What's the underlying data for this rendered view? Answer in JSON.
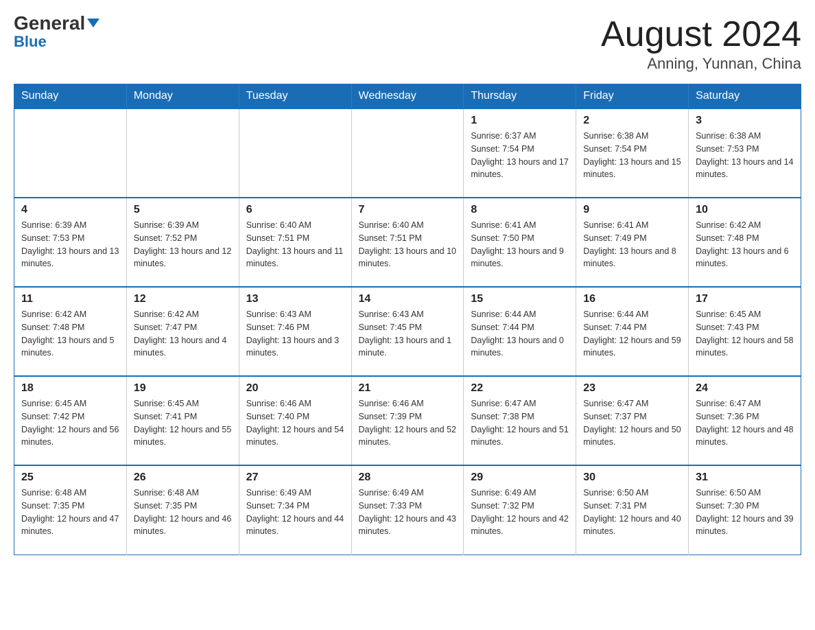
{
  "header": {
    "logo_general": "General",
    "logo_blue": "Blue",
    "title": "August 2024",
    "location": "Anning, Yunnan, China"
  },
  "days_of_week": [
    "Sunday",
    "Monday",
    "Tuesday",
    "Wednesday",
    "Thursday",
    "Friday",
    "Saturday"
  ],
  "weeks": [
    [
      {
        "day": "",
        "info": ""
      },
      {
        "day": "",
        "info": ""
      },
      {
        "day": "",
        "info": ""
      },
      {
        "day": "",
        "info": ""
      },
      {
        "day": "1",
        "info": "Sunrise: 6:37 AM\nSunset: 7:54 PM\nDaylight: 13 hours and 17 minutes."
      },
      {
        "day": "2",
        "info": "Sunrise: 6:38 AM\nSunset: 7:54 PM\nDaylight: 13 hours and 15 minutes."
      },
      {
        "day": "3",
        "info": "Sunrise: 6:38 AM\nSunset: 7:53 PM\nDaylight: 13 hours and 14 minutes."
      }
    ],
    [
      {
        "day": "4",
        "info": "Sunrise: 6:39 AM\nSunset: 7:53 PM\nDaylight: 13 hours and 13 minutes."
      },
      {
        "day": "5",
        "info": "Sunrise: 6:39 AM\nSunset: 7:52 PM\nDaylight: 13 hours and 12 minutes."
      },
      {
        "day": "6",
        "info": "Sunrise: 6:40 AM\nSunset: 7:51 PM\nDaylight: 13 hours and 11 minutes."
      },
      {
        "day": "7",
        "info": "Sunrise: 6:40 AM\nSunset: 7:51 PM\nDaylight: 13 hours and 10 minutes."
      },
      {
        "day": "8",
        "info": "Sunrise: 6:41 AM\nSunset: 7:50 PM\nDaylight: 13 hours and 9 minutes."
      },
      {
        "day": "9",
        "info": "Sunrise: 6:41 AM\nSunset: 7:49 PM\nDaylight: 13 hours and 8 minutes."
      },
      {
        "day": "10",
        "info": "Sunrise: 6:42 AM\nSunset: 7:48 PM\nDaylight: 13 hours and 6 minutes."
      }
    ],
    [
      {
        "day": "11",
        "info": "Sunrise: 6:42 AM\nSunset: 7:48 PM\nDaylight: 13 hours and 5 minutes."
      },
      {
        "day": "12",
        "info": "Sunrise: 6:42 AM\nSunset: 7:47 PM\nDaylight: 13 hours and 4 minutes."
      },
      {
        "day": "13",
        "info": "Sunrise: 6:43 AM\nSunset: 7:46 PM\nDaylight: 13 hours and 3 minutes."
      },
      {
        "day": "14",
        "info": "Sunrise: 6:43 AM\nSunset: 7:45 PM\nDaylight: 13 hours and 1 minute."
      },
      {
        "day": "15",
        "info": "Sunrise: 6:44 AM\nSunset: 7:44 PM\nDaylight: 13 hours and 0 minutes."
      },
      {
        "day": "16",
        "info": "Sunrise: 6:44 AM\nSunset: 7:44 PM\nDaylight: 12 hours and 59 minutes."
      },
      {
        "day": "17",
        "info": "Sunrise: 6:45 AM\nSunset: 7:43 PM\nDaylight: 12 hours and 58 minutes."
      }
    ],
    [
      {
        "day": "18",
        "info": "Sunrise: 6:45 AM\nSunset: 7:42 PM\nDaylight: 12 hours and 56 minutes."
      },
      {
        "day": "19",
        "info": "Sunrise: 6:45 AM\nSunset: 7:41 PM\nDaylight: 12 hours and 55 minutes."
      },
      {
        "day": "20",
        "info": "Sunrise: 6:46 AM\nSunset: 7:40 PM\nDaylight: 12 hours and 54 minutes."
      },
      {
        "day": "21",
        "info": "Sunrise: 6:46 AM\nSunset: 7:39 PM\nDaylight: 12 hours and 52 minutes."
      },
      {
        "day": "22",
        "info": "Sunrise: 6:47 AM\nSunset: 7:38 PM\nDaylight: 12 hours and 51 minutes."
      },
      {
        "day": "23",
        "info": "Sunrise: 6:47 AM\nSunset: 7:37 PM\nDaylight: 12 hours and 50 minutes."
      },
      {
        "day": "24",
        "info": "Sunrise: 6:47 AM\nSunset: 7:36 PM\nDaylight: 12 hours and 48 minutes."
      }
    ],
    [
      {
        "day": "25",
        "info": "Sunrise: 6:48 AM\nSunset: 7:35 PM\nDaylight: 12 hours and 47 minutes."
      },
      {
        "day": "26",
        "info": "Sunrise: 6:48 AM\nSunset: 7:35 PM\nDaylight: 12 hours and 46 minutes."
      },
      {
        "day": "27",
        "info": "Sunrise: 6:49 AM\nSunset: 7:34 PM\nDaylight: 12 hours and 44 minutes."
      },
      {
        "day": "28",
        "info": "Sunrise: 6:49 AM\nSunset: 7:33 PM\nDaylight: 12 hours and 43 minutes."
      },
      {
        "day": "29",
        "info": "Sunrise: 6:49 AM\nSunset: 7:32 PM\nDaylight: 12 hours and 42 minutes."
      },
      {
        "day": "30",
        "info": "Sunrise: 6:50 AM\nSunset: 7:31 PM\nDaylight: 12 hours and 40 minutes."
      },
      {
        "day": "31",
        "info": "Sunrise: 6:50 AM\nSunset: 7:30 PM\nDaylight: 12 hours and 39 minutes."
      }
    ]
  ]
}
